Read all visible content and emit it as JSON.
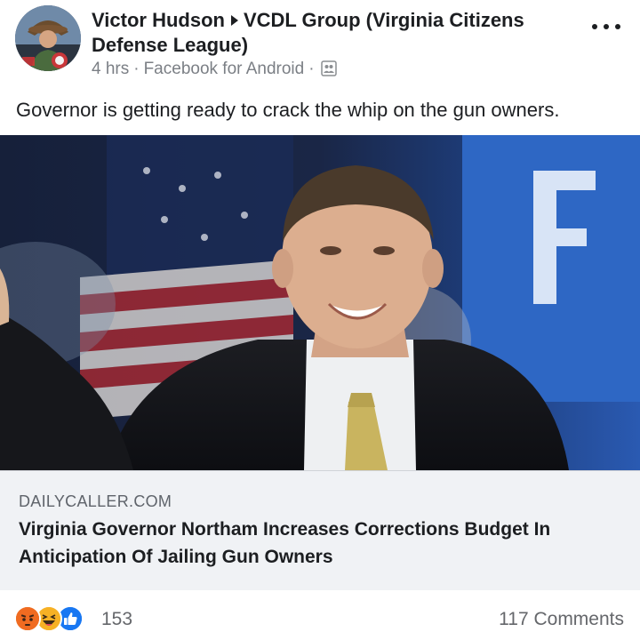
{
  "post": {
    "author": "Victor Hudson",
    "group": "VCDL Group (Virginia Citizens Defense League)",
    "time": "4 hrs",
    "source": "Facebook for Android",
    "caption": "Governor is getting ready to crack the whip on the gun owners."
  },
  "link": {
    "domain": "DAILYCALLER.COM",
    "headline": "Virginia Governor Northam Increases Corrections Budget In Anticipation Of Jailing Gun Owners"
  },
  "footer": {
    "reaction_count": "153",
    "comments": "117 Comments",
    "reactions": [
      "angry-icon",
      "haha-icon",
      "like-icon"
    ]
  },
  "icons": {
    "more": "more-dots-icon",
    "audience": "friends-icon",
    "separator": "triangle-arrow-icon"
  },
  "colors": {
    "text": "#1c1e21",
    "meta": "#7b7f85",
    "link_bg": "#f0f2f5",
    "like_blue": "#1877f2",
    "angry_orange": "#e9710f",
    "haha_yellow": "#f7b125"
  }
}
